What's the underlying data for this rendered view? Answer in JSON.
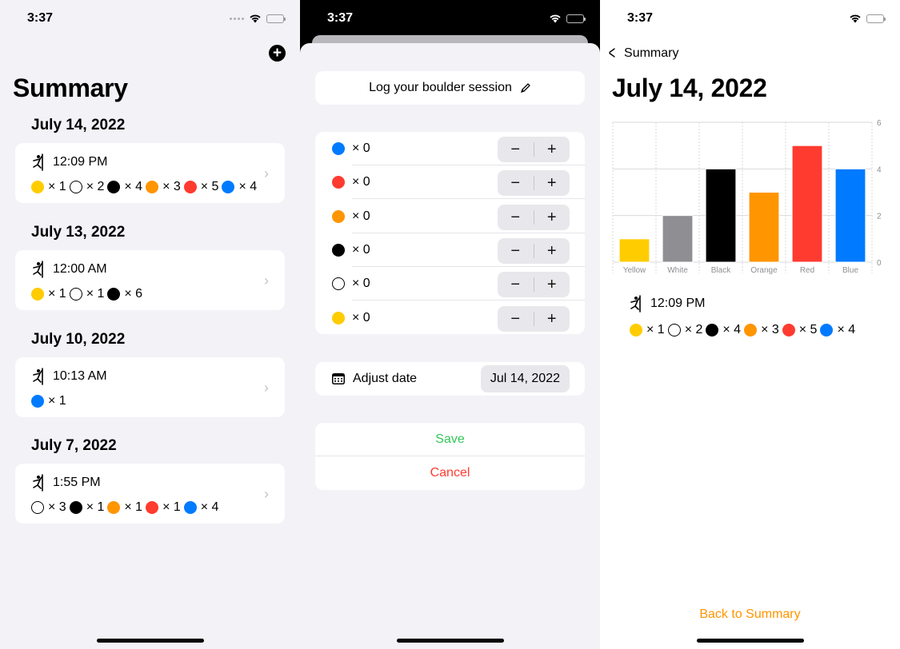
{
  "colors": {
    "Yellow": "#ffcc00",
    "White": "#ffffff",
    "Black": "#000000",
    "Orange": "#ff9500",
    "Red": "#ff3b30",
    "Blue": "#007aff",
    "accent": "#ff9500",
    "save": "#34c759",
    "cancel": "#ff3b30"
  },
  "status": {
    "time": "3:37"
  },
  "summary": {
    "title": "Summary",
    "add_icon": "plus-circle-icon",
    "sections": [
      {
        "date": "July 14, 2022",
        "time": "12:09 PM",
        "counts": [
          {
            "color": "Yellow",
            "label": "× 1"
          },
          {
            "color": "White",
            "label": "× 2"
          },
          {
            "color": "Black",
            "label": "× 4"
          },
          {
            "color": "Orange",
            "label": "× 3"
          },
          {
            "color": "Red",
            "label": "× 5"
          },
          {
            "color": "Blue",
            "label": "× 4"
          }
        ]
      },
      {
        "date": "July 13, 2022",
        "time": "12:00 AM",
        "counts": [
          {
            "color": "Yellow",
            "label": "× 1"
          },
          {
            "color": "White",
            "label": "× 1"
          },
          {
            "color": "Black",
            "label": "× 6"
          }
        ]
      },
      {
        "date": "July 10, 2022",
        "time": "10:13 AM",
        "counts": [
          {
            "color": "Blue",
            "label": "× 1"
          }
        ]
      },
      {
        "date": "July 7, 2022",
        "time": "1:55 PM",
        "counts": [
          {
            "color": "White",
            "label": "× 3"
          },
          {
            "color": "Black",
            "label": "× 1"
          },
          {
            "color": "Orange",
            "label": "× 1"
          },
          {
            "color": "Red",
            "label": "× 1"
          },
          {
            "color": "Blue",
            "label": "× 4"
          }
        ]
      }
    ]
  },
  "log": {
    "title": "Log your boulder session",
    "edit_icon": "pencil-icon",
    "counters": [
      {
        "color": "Blue",
        "label": "× 0"
      },
      {
        "color": "Red",
        "label": "× 0"
      },
      {
        "color": "Orange",
        "label": "× 0"
      },
      {
        "color": "Black",
        "label": "× 0"
      },
      {
        "color": "White",
        "label": "× 0"
      },
      {
        "color": "Yellow",
        "label": "× 0"
      }
    ],
    "minus": "−",
    "plus": "+",
    "adjust_date_label": "Adjust date",
    "date_value": "Jul 14, 2022",
    "save": "Save",
    "cancel": "Cancel"
  },
  "detail": {
    "back_label": "Summary",
    "title": "July 14, 2022",
    "time": "12:09 PM",
    "counts": [
      {
        "color": "Yellow",
        "label": "× 1"
      },
      {
        "color": "White",
        "label": "× 2"
      },
      {
        "color": "Black",
        "label": "× 4"
      },
      {
        "color": "Orange",
        "label": "× 3"
      },
      {
        "color": "Red",
        "label": "× 5"
      },
      {
        "color": "Blue",
        "label": "× 4"
      }
    ],
    "back_to_summary": "Back to Summary"
  },
  "chart_data": {
    "type": "bar",
    "categories": [
      "Yellow",
      "White",
      "Black",
      "Orange",
      "Red",
      "Blue"
    ],
    "values": [
      1,
      2,
      4,
      3,
      5,
      4
    ],
    "bar_colors": [
      "#ffcc00",
      "#8e8e93",
      "#000000",
      "#ff9500",
      "#ff3b30",
      "#007aff"
    ],
    "yticks": [
      0,
      2,
      4,
      6
    ],
    "ylim": [
      0,
      6
    ],
    "grid": true,
    "y_axis_side": "right"
  }
}
